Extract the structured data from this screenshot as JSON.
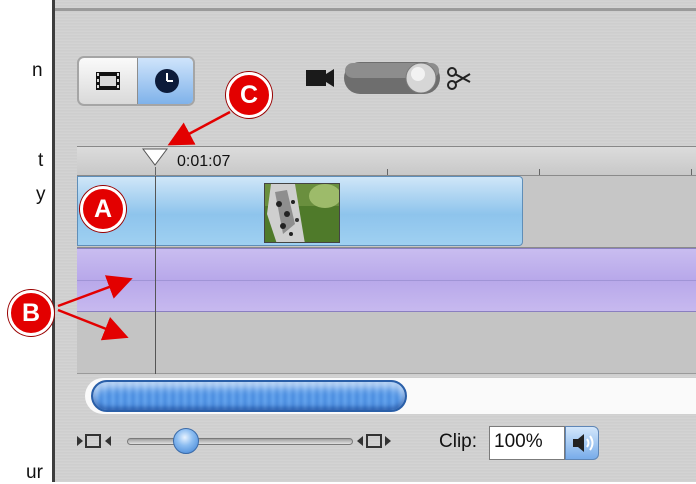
{
  "left_page_text": {
    "line1": "n",
    "line2": "t",
    "line3": "y",
    "line4": "ur"
  },
  "timeline": {
    "timecode": "0:01:07"
  },
  "footer": {
    "clip_label": "Clip:",
    "clip_value": "100%"
  },
  "callouts": {
    "a": "A",
    "b": "B",
    "c": "C"
  },
  "icons": {
    "clip_view": "filmstrip-icon",
    "time_view": "clock-icon",
    "camera": "camera-icon",
    "scissors": "scissors-icon",
    "zoom_out": "zoom-out-icon",
    "zoom_in": "zoom-in-icon",
    "speaker": "speaker-icon"
  },
  "colors": {
    "callout_red": "#e30000",
    "video_clip_blue": "#8ec4ec",
    "audio_track_purple": "#b8a8ea",
    "scroll_thumb_blue": "#4d8fe0"
  },
  "state": {
    "active_view": "time_view",
    "zoom_level": 0.2,
    "scroll_position": 0.0
  }
}
